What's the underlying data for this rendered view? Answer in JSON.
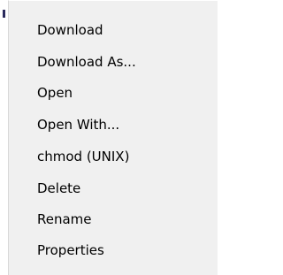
{
  "context_menu": {
    "items": [
      {
        "label": "Download"
      },
      {
        "label": "Download As..."
      },
      {
        "label": "Open"
      },
      {
        "label": "Open With..."
      },
      {
        "label": "chmod (UNIX)"
      },
      {
        "label": "Delete"
      },
      {
        "label": "Rename"
      },
      {
        "label": "Properties"
      }
    ]
  },
  "colors": {
    "menu_background": "#f0f0f0",
    "menu_border": "#d8d8d8",
    "text": "#000000",
    "marker": "#2a2a5c"
  }
}
